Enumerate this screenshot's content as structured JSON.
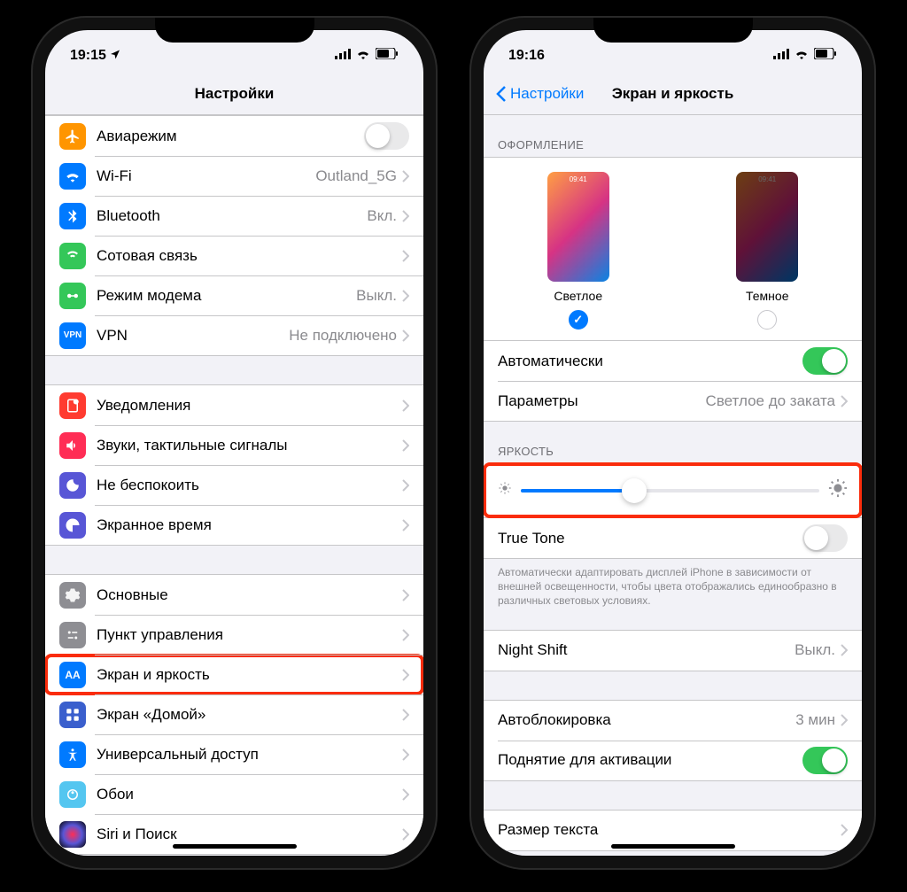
{
  "left": {
    "status": {
      "time": "19:15"
    },
    "nav": {
      "title": "Настройки"
    },
    "g1": [
      {
        "icon": "airplane-icon",
        "color": "#ff9500",
        "label": "Авиарежим",
        "toggle": false
      },
      {
        "icon": "wifi-icon",
        "color": "#007aff",
        "label": "Wi-Fi",
        "value": "Outland_5G"
      },
      {
        "icon": "bluetooth-icon",
        "color": "#007aff",
        "label": "Bluetooth",
        "value": "Вкл."
      },
      {
        "icon": "cellular-icon",
        "color": "#34c759",
        "label": "Сотовая связь",
        "value": ""
      },
      {
        "icon": "hotspot-icon",
        "color": "#34c759",
        "label": "Режим модема",
        "value": "Выкл."
      },
      {
        "icon": "vpn-icon",
        "color": "#007aff",
        "label": "VPN",
        "value": "Не подключено"
      }
    ],
    "g2": [
      {
        "icon": "notifications-icon",
        "color": "#ff3b30",
        "label": "Уведомления"
      },
      {
        "icon": "sounds-icon",
        "color": "#ff2d55",
        "label": "Звуки, тактильные сигналы"
      },
      {
        "icon": "dnd-icon",
        "color": "#5856d6",
        "label": "Не беспокоить"
      },
      {
        "icon": "screentime-icon",
        "color": "#5856d6",
        "label": "Экранное время"
      }
    ],
    "g3": [
      {
        "icon": "general-icon",
        "color": "#8e8e93",
        "label": "Основные"
      },
      {
        "icon": "control-center-icon",
        "color": "#8e8e93",
        "label": "Пункт управления"
      },
      {
        "icon": "display-icon",
        "color": "#007aff",
        "label": "Экран и яркость",
        "highlight": true
      },
      {
        "icon": "home-screen-icon",
        "color": "#2860cf",
        "label": "Экран «Домой»"
      },
      {
        "icon": "accessibility-icon",
        "color": "#007aff",
        "label": "Универсальный доступ"
      },
      {
        "icon": "wallpaper-icon",
        "color": "#54c6f0",
        "label": "Обои"
      },
      {
        "icon": "siri-icon",
        "color": "#222",
        "label": "Siri и Поиск"
      }
    ]
  },
  "right": {
    "status": {
      "time": "19:16"
    },
    "nav": {
      "back": "Настройки",
      "title": "Экран и яркость"
    },
    "appearance": {
      "header": "Оформление",
      "light": {
        "label": "Светлое",
        "time": "09:41",
        "selected": true
      },
      "dark": {
        "label": "Темное",
        "time": "09:41",
        "selected": false
      }
    },
    "auto": {
      "label": "Автоматически",
      "on": true
    },
    "options": {
      "label": "Параметры",
      "value": "Светлое до заката"
    },
    "brightness": {
      "header": "Яркость",
      "value": 38
    },
    "truetone": {
      "label": "True Tone",
      "on": false,
      "footer": "Автоматически адаптировать дисплей iPhone в зависимости от внешней освещенности, чтобы цвета отображались единообразно в различных световых условиях."
    },
    "nightshift": {
      "label": "Night Shift",
      "value": "Выкл."
    },
    "autolock": {
      "label": "Автоблокировка",
      "value": "3 мин"
    },
    "raise": {
      "label": "Поднятие для активации",
      "on": true
    },
    "textsize": {
      "label": "Размер текста"
    }
  }
}
